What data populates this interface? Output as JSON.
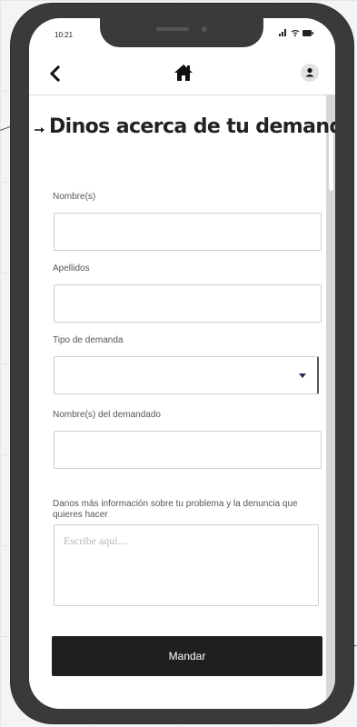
{
  "status_bar": {
    "time": "10:21"
  },
  "nav": {
    "back_icon": "chevron-left-icon",
    "home_icon": "home-icon",
    "profile_icon": "user-icon"
  },
  "form": {
    "title": "Dinos acerca de tu demanda",
    "fields": [
      {
        "label": "Nombre(s)",
        "value": ""
      },
      {
        "label": "Apellidos",
        "value": ""
      },
      {
        "label": "Tipo de demanda",
        "value": ""
      },
      {
        "label": "Nombre(s) del demandado",
        "value": ""
      }
    ],
    "description": {
      "label": "Danos más información sobre tu problema y la denuncia que quieres hacer",
      "placeholder": "Escribe aquí...."
    },
    "submit_label": "Mandar"
  },
  "colors": {
    "phone_frame": "#3a3a3a",
    "button_bg": "#1f1f1f",
    "button_text": "#ffffff",
    "select_arrow": "#1d2a57"
  }
}
